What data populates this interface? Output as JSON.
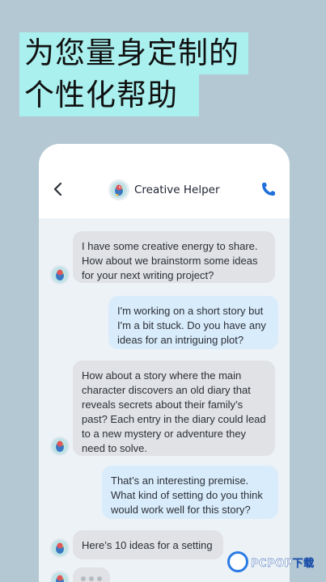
{
  "headline": {
    "line1": "为您量身定制的",
    "line2": "个性化帮助"
  },
  "header": {
    "title": "Creative Helper",
    "back_icon": "chevron-left-icon",
    "call_icon": "phone-icon"
  },
  "messages": [
    {
      "role": "bot",
      "text": "I have some creative energy to share. How about we brainstorm some ideas for your next writing project?"
    },
    {
      "role": "user",
      "text": "I'm working on a short story but I'm a bit stuck. Do you have any ideas for an intriguing plot?"
    },
    {
      "role": "bot",
      "text": "How about a story where the main character discovers an old diary that reveals secrets about their family’s past? Each entry in the diary could lead to a new mystery or adventure they need to solve."
    },
    {
      "role": "user",
      "text": "That’s an interesting premise. What kind of setting do you think would work well for this story?"
    },
    {
      "role": "bot",
      "text": "Here’s 10 ideas for a setting"
    }
  ],
  "watermark": {
    "text": "PCPOP下载"
  },
  "colors": {
    "background": "#b4c8d3",
    "headline_highlight": "#a9f0ef",
    "bot_bubble": "#e0e2e5",
    "user_bubble": "#d9ecfb",
    "accent": "#1e6fd9"
  }
}
